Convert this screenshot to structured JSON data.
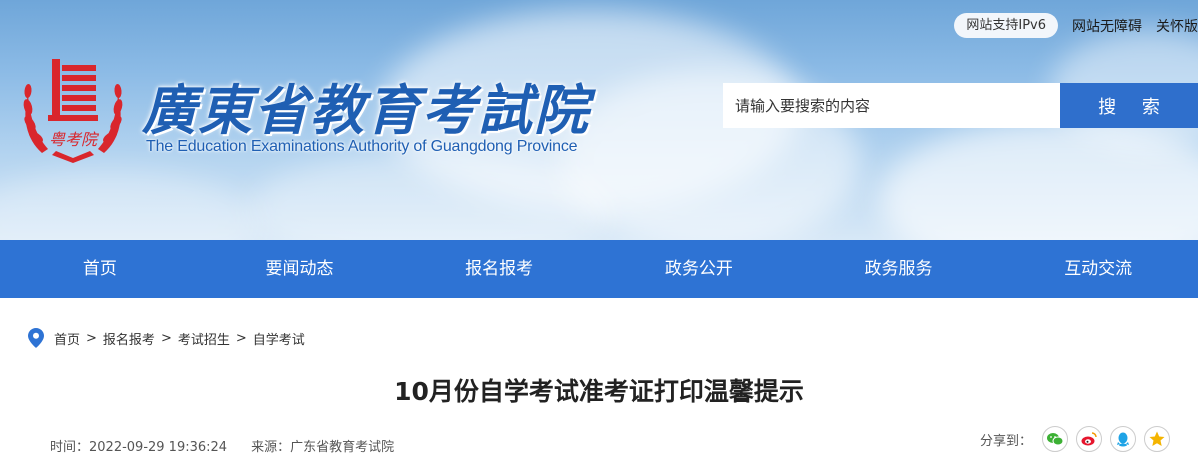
{
  "header": {
    "ipv6_label": "网站支持IPv6",
    "accessibility_link": "网站无障碍",
    "care_link": "关怀版",
    "title_cn": "廣東省教育考試院",
    "title_en": "The Education Examinations Authority of Guangdong Province",
    "logo_text": "粤考院"
  },
  "search": {
    "placeholder": "请输入要搜索的内容",
    "button_label": "搜 索"
  },
  "nav": {
    "items": [
      "首页",
      "要闻动态",
      "报名报考",
      "政务公开",
      "政务服务",
      "互动交流"
    ]
  },
  "breadcrumb": {
    "items": [
      "首页",
      "报名报考",
      "考试招生",
      "自学考试"
    ],
    "separator": ">"
  },
  "article": {
    "title": "10月份自学考试准考证打印温馨提示",
    "time": "时间：2022-09-29 19:36:24",
    "source": "来源：广东省教育考试院"
  },
  "share": {
    "label": "分享到：",
    "icons": [
      "wechat-icon",
      "weibo-icon",
      "qq-icon",
      "qzone-icon"
    ]
  },
  "colors": {
    "nav_bg": "#2e73d4",
    "search_button": "#2f6fcc",
    "title_blue": "#1f5fb3",
    "logo_red": "#d9262c",
    "wechat": "#3cb034",
    "weibo": "#e6162d",
    "qq": "#1ea3e6",
    "qzone": "#f4b400"
  }
}
